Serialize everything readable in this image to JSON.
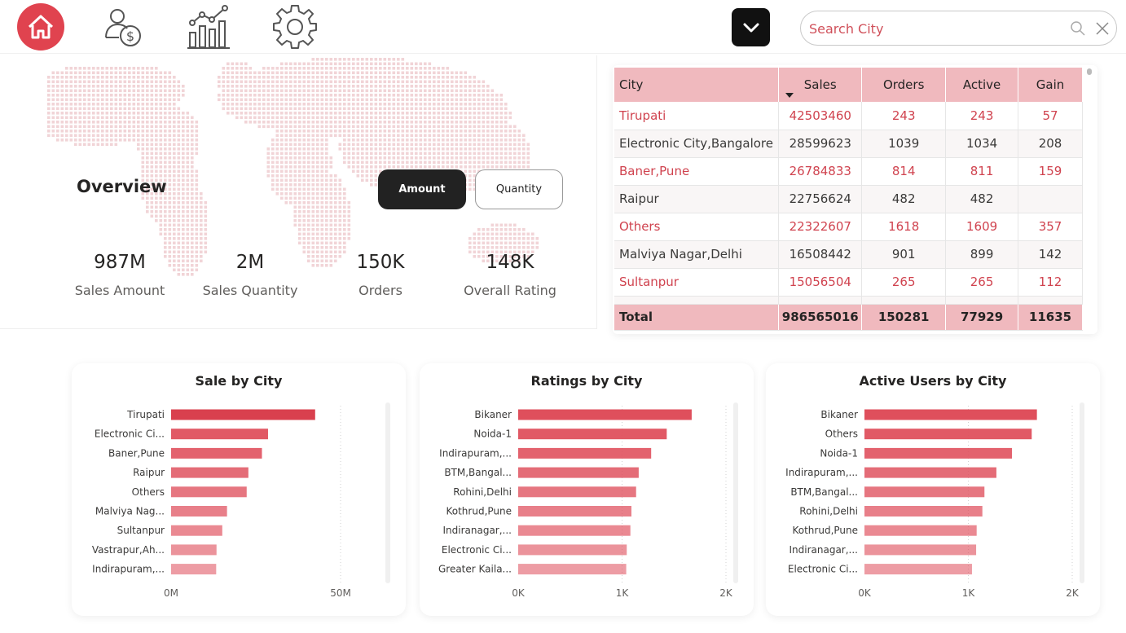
{
  "nav": {
    "icons": [
      "home-icon",
      "sales-money-icon",
      "growth-chart-icon",
      "settings-gear-icon"
    ],
    "search_placeholder": "Search City"
  },
  "colors": {
    "accent": "#e0434f",
    "header_pink": "#f0b9be",
    "bar": "#e05a66"
  },
  "overview": {
    "title": "Overview",
    "toggle_amount": "Amount",
    "toggle_quantity": "Quantity",
    "kpis": [
      {
        "value": "987M",
        "label": "Sales Amount"
      },
      {
        "value": "2M",
        "label": "Sales Quantity"
      },
      {
        "value": "150K",
        "label": "Orders"
      },
      {
        "value": "148K",
        "label": "Overall Rating"
      }
    ]
  },
  "table": {
    "headers": [
      "City",
      "Sales",
      "Orders",
      "Active",
      "Gain"
    ],
    "rows": [
      [
        "Tirupati",
        "42503460",
        "243",
        "243",
        "57"
      ],
      [
        "Electronic City,Bangalore",
        "28599623",
        "1039",
        "1034",
        "208"
      ],
      [
        "Baner,Pune",
        "26784833",
        "814",
        "811",
        "159"
      ],
      [
        "Raipur",
        "22756624",
        "482",
        "482",
        ""
      ],
      [
        "Others",
        "22322607",
        "1618",
        "1609",
        "357"
      ],
      [
        "Malviya Nagar,Delhi",
        "16508442",
        "901",
        "899",
        "142"
      ],
      [
        "Sultanpur",
        "15056504",
        "265",
        "265",
        "112"
      ]
    ],
    "total": [
      "Total",
      "986565016",
      "150281",
      "77929",
      "11635"
    ]
  },
  "chart_data": [
    {
      "type": "bar",
      "title": "Sale by City",
      "categories": [
        "Tirupati",
        "Electronic Ci...",
        "Baner,Pune",
        "Raipur",
        "Others",
        "Malviya Nag...",
        "Sultanpur",
        "Vastrapur,Ah...",
        "Indirapuram,..."
      ],
      "values": [
        42.5,
        28.6,
        26.8,
        22.8,
        22.3,
        16.5,
        15.1,
        13.4,
        13.3
      ],
      "unit": "M",
      "xlim": [
        0,
        50
      ],
      "ticks": [
        {
          "v": 0,
          "label": "0M"
        },
        {
          "v": 50,
          "label": "50M"
        }
      ]
    },
    {
      "type": "bar",
      "title": "Ratings by City",
      "categories": [
        "Bikaner",
        "Noida-1",
        "Indirapuram,...",
        "BTM,Bangal...",
        "Rohini,Delhi",
        "Kothrud,Pune",
        "Indiranagar,...",
        "Electronic Ci...",
        "Greater Kaila..."
      ],
      "values": [
        1670,
        1430,
        1280,
        1160,
        1135,
        1090,
        1080,
        1045,
        1040
      ],
      "xlim": [
        0,
        2000
      ],
      "ticks": [
        {
          "v": 0,
          "label": "0K"
        },
        {
          "v": 1000,
          "label": "1K"
        },
        {
          "v": 2000,
          "label": "2K"
        }
      ]
    },
    {
      "type": "bar",
      "title": "Active Users by City",
      "categories": [
        "Bikaner",
        "Others",
        "Noida-1",
        "Indirapuram,...",
        "BTM,Bangal...",
        "Rohini,Delhi",
        "Kothrud,Pune",
        "Indiranagar,...",
        "Electronic Ci..."
      ],
      "values": [
        1660,
        1610,
        1420,
        1270,
        1155,
        1135,
        1080,
        1075,
        1035
      ],
      "xlim": [
        0,
        2000
      ],
      "ticks": [
        {
          "v": 0,
          "label": "0K"
        },
        {
          "v": 1000,
          "label": "1K"
        },
        {
          "v": 2000,
          "label": "2K"
        }
      ]
    }
  ]
}
